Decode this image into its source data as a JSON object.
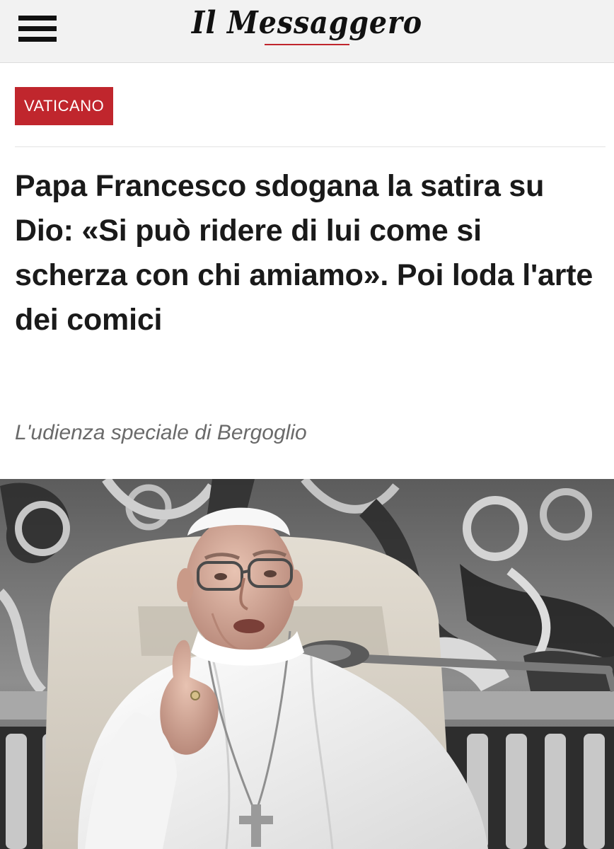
{
  "header": {
    "logo": "Il Messaggero",
    "menu_icon": "hamburger-menu-icon"
  },
  "article": {
    "category": "VATICANO",
    "headline": "Papa Francesco sdogana la satira su Dio: «Si può ridere di lui come si scherza con chi amiamo». Poi loda l'arte dei comici",
    "subtitle": "L'udienza speciale di Bergoglio"
  },
  "colors": {
    "brand_red": "#c0262d",
    "header_bg": "#f2f2f2",
    "headline_text": "#1a1a1a",
    "subtitle_text": "#6a6a6a"
  }
}
